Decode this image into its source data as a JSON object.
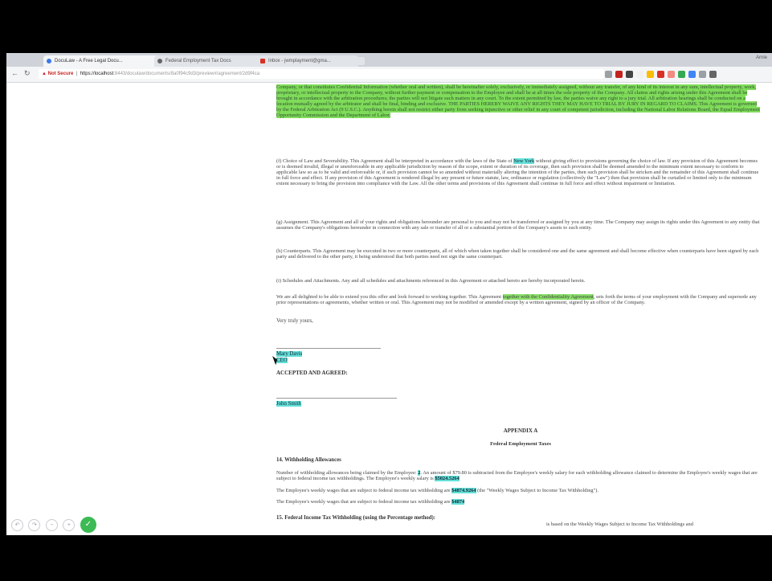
{
  "browser": {
    "tabs": [
      {
        "label": "DocuLaw - A Free Legal Docu..."
      },
      {
        "label": "Federal Employment Tax Docs"
      },
      {
        "label": "Inbox - jwmplayment@gma..."
      }
    ],
    "window_user": "Arnie",
    "address": {
      "warning": "Not Secure",
      "host": "https://localhost",
      "path": ":8443/doculaw/documents/8a0f94c9d3/preview#/agreement/2d9f4ca"
    },
    "icons": {
      "back": "back-arrow-icon",
      "reload": "reload-icon",
      "warning": "warning-icon"
    },
    "extensions": [
      "#9aa0a6",
      "#c5221f",
      "#444444",
      "#f0f0f0",
      "#fbbc04",
      "#d93025",
      "#f28b82",
      "#34a853",
      "#4285f4",
      "#9aa0a6",
      "#666666"
    ]
  },
  "document": {
    "green_block": "Company, or that constitutes Confidential Information (whether oral and written), shall be hereinafter solely, exclusively, or immediately assigned, without any transfer, of any kind of its interest in any sum, intellectual property, work, proprietary, or intellectual property to the Company, without further payment or compensation to the Employee and shall be at all times the sole property of the Company. All claims and rights arising under this Agreement shall be brought in accordance with the arbitration procedures; the parties will not litigate such matters in any court. To the extent permitted by law, the parties waive any right to a jury trial. All arbitration hearings shall be conducted on a location mutually agreed by the arbitrator and shall be final, binding and exclusive. THE PARTIES HEREBY WAIVE ANY RIGHTS THEY MAY HAVE TO TRIAL BY JURY IN REGARD TO CLAIMS. This Agreement is governed by the Federal Arbitration Act (9 U.S.C.). Anything herein shall not restrict either party from seeking injunctive or other relief in any court of competent jurisdiction, including the National Labor Relations Board, the Equal Employment Opportunity Commission and the Department of Labor.",
    "p10_pre": "(f) Choice of Law and Severability. This Agreement shall be interpreted in accordance with the laws of the State of ",
    "p10_state": "New York",
    "p10_post": " without giving effect to provisions governing the choice of law. If any provision of this Agreement becomes or is deemed invalid, illegal or unenforceable in any applicable jurisdiction by reason of the scope, extent or duration of its coverage, then such provision shall be deemed amended to the minimum extent necessary to conform to applicable law so as to be valid and enforceable or, if such provision cannot be so amended without materially altering the intention of the parties, then such provision shall be stricken and the remainder of this Agreement shall continue in full force and effect. If any provision of this Agreement is rendered illegal by any present or future statute, law, ordinance or regulation (collectively the \"Law\") then that provision shall be curtailed or limited only to the minimum extent necessary to bring the provision into compliance with the Law. All the other terms and provisions of this Agreement shall continue in full force and effect without impairment or limitation.",
    "p11": "(g) Assignment. This Agreement and all of your rights and obligations hereunder are personal to you and may not be transferred or assigned by you at any time. The Company may assign its rights under this Agreement to any entity that assumes the Company's obligations hereunder in connection with any sale or transfer of all or a substantial portion of the Company's assets to such entity.",
    "p12": "(h) Counterparts. This Agreement may be executed in two or more counterparts, all of which when taken together shall be considered one and the same agreement and shall become effective when counterparts have been signed by each party and delivered to the other party, it being understood that both parties need not sign the same counterpart.",
    "p13": "(i) Schedules and Attachments. Any and all schedules and attachments referenced in this Agreement or attached hereto are hereby incorporated herein.",
    "p14_pre": "We are all delighted to be able to extend you this offer and look forward to working together. This Agreement ",
    "p14_hl": "together with the Confidentiality Agreement",
    "p14_post": ", sets forth the terms of your employment with the Company and supersede any prior representations or agreements, whether written or oral. This Agreement may not be modified or amended except by a written agreement, signed by an officer of the Company.",
    "closing": "Very truly yours,",
    "signer_name": "Mary Davis",
    "signer_title": "CEO",
    "accepted": "ACCEPTED AND AGREED:",
    "employee_name": "John Smith",
    "appendix_title": "APPENDIX A",
    "appendix_subtitle": "Federal Employment Taxes",
    "sec14_title": "14. Withholding Allowances",
    "sec14_p1_pre": "Number of withholding allowances being claimed by the Employee: ",
    "sec14_allow": "2",
    "sec14_p1_mid": ". An amount of $79.80 is subtracted from the Employee's weekly salary for each withholding allowance claimed to determine the Employee's weekly wages that are subject to federal income tax withholdings. The Employee's weekly salary is ",
    "sec14_salary": "$5024.5264",
    "sec14_p2_pre": "The Employee's weekly wages that are subject to federal income tax withholding are ",
    "sec14_wages": "$4874.9264",
    "sec14_p2_post": " (the \"Weekly Wages Subject to Income Tax Withholding\").",
    "sec14_p3_pre": "The Employee's weekly wages that are subject to federal income tax withholding are ",
    "sec14_wages2": "$4874",
    "sec15_title": "15. Federal Income Tax Withholding (using the Percentage method):",
    "sec15_tail": "is based on the Weekly Wages Subject to Income Tax Withholdings and"
  },
  "annotation_toolbar": {
    "icons": [
      "undo-icon",
      "redo-icon",
      "zoom-out-icon",
      "zoom-in-icon"
    ],
    "confirm": "check-icon"
  }
}
